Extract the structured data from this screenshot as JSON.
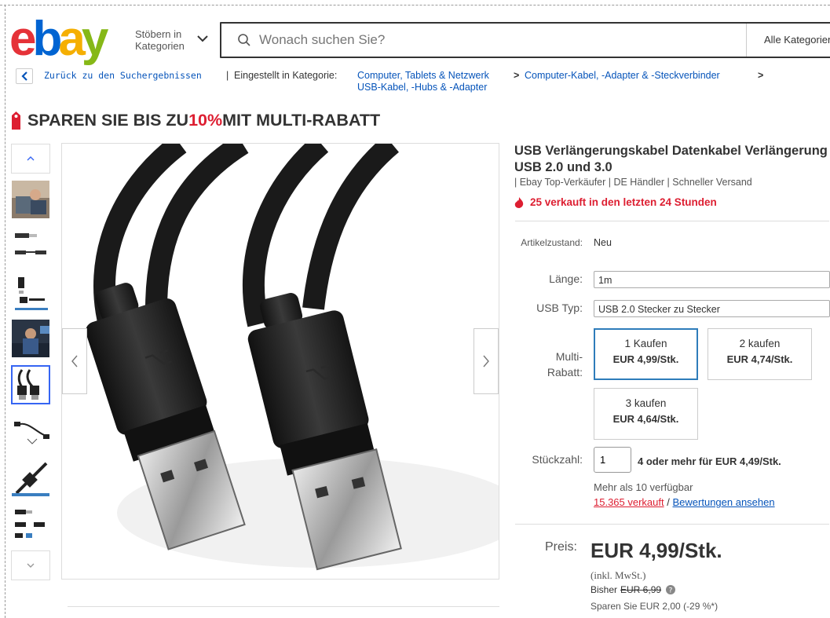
{
  "header": {
    "logo": {
      "e": "e",
      "b": "b",
      "a": "a",
      "y": "y"
    },
    "browse_label_1": "Stöbern in",
    "browse_label_2": "Kategorien",
    "search_placeholder": "Wonach suchen Sie?",
    "category_select": "Alle Kategorien"
  },
  "breadcrumb": {
    "back": "Zurück zu den Suchergebnissen",
    "separator": "|",
    "label": "Eingestellt in Kategorie:",
    "cat1": "Computer, Tablets & Netzwerk",
    "cat2": "Computer-Kabel, -Adapter & -Steckverbinder",
    "cat3": "USB-Kabel, -Hubs & -Adapter",
    "arrow": ">"
  },
  "promo": {
    "pre": "SPAREN SIE BIS ZU ",
    "pct": "10%",
    "post": " MIT MULTI-RABATT"
  },
  "product": {
    "title": "USB Verlängerungskabel Datenkabel Verlängerung USB 2.0 und 3.0",
    "subtitle": "| Ebay Top-Verkäufer | DE Händler | Schneller Versand",
    "sold_recent": "25 verkauft in den letzten 24 Stunden",
    "condition_label": "Artikelzustand:",
    "condition_value": "Neu",
    "length_label": "Länge:",
    "length_value": "1m",
    "usb_label": "USB Typ:",
    "usb_value": "USB 2.0 Stecker zu Stecker",
    "multi_label_1": "Multi-",
    "multi_label_2": "Rabatt:",
    "tiers": [
      {
        "qty": "1 Kaufen",
        "price": "EUR 4,99/Stk."
      },
      {
        "qty": "2 kaufen",
        "price": "EUR 4,74/Stk."
      },
      {
        "qty": "3 kaufen",
        "price": "EUR 4,64/Stk."
      }
    ],
    "qty_label": "Stückzahl:",
    "qty_value": "1",
    "qty_offer": "4 oder mehr für EUR 4,49/Stk.",
    "available": "Mehr als 10 verfügbar",
    "sold_total": "15.365 verkauft",
    "slash": "/",
    "reviews": "Bewertungen ansehen",
    "price_label": "Preis:",
    "price": "EUR 4,99/Stk.",
    "vat": "(inkl. MwSt.)",
    "was_label": "Bisher",
    "was_price": "EUR 6,99",
    "save": "Sparen Sie EUR 2,00 (-29 %*)"
  },
  "colors": {
    "ebay_red": "#e53238",
    "ebay_blue": "#0064d2",
    "ebay_yellow": "#f5af02",
    "ebay_green": "#86b817",
    "link": "#0654ba",
    "alert": "#dd1e31"
  }
}
